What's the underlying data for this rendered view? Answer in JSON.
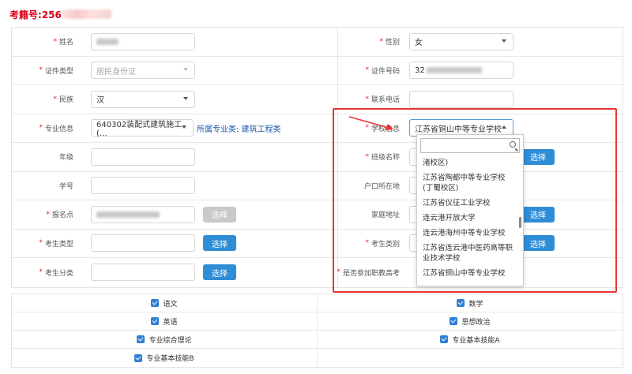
{
  "exam_no": {
    "label": "考籍号:",
    "value": "256"
  },
  "form": {
    "name": {
      "label": "姓名"
    },
    "gender": {
      "label": "性别",
      "value": "女"
    },
    "id_type": {
      "label": "证件类型",
      "value": "居民身份证"
    },
    "id_number": {
      "label": "证件号码",
      "value": "32"
    },
    "ethnicity": {
      "label": "民族",
      "value": "汉"
    },
    "phone": {
      "label": "联系电话"
    },
    "major": {
      "label": "专业信息",
      "value": "640302装配式建筑施工(…",
      "category": "所属专业类: 建筑工程类"
    },
    "school": {
      "label": "学校信息",
      "value": "江苏省铜山中等专业学校"
    },
    "grade_no": {
      "label": "年级"
    },
    "class_name": {
      "label": "班级名称",
      "button": "选择"
    },
    "student_no": {
      "label": "学号"
    },
    "household": {
      "label": "户口所在地"
    },
    "exam_site": {
      "label": "报名点",
      "button": "选择"
    },
    "home_address": {
      "label": "家庭地址",
      "button": "选择"
    },
    "candidate_type": {
      "label": "考生类型",
      "button": "选择"
    },
    "candidate_category": {
      "label": "考生类别",
      "button": "选择"
    },
    "candidate_class": {
      "label": "考生分类",
      "button": "选择"
    },
    "vocational": {
      "label": "是否参加职教高考"
    }
  },
  "dropdown": {
    "items": [
      "渚校区)",
      "江苏省陶都中等专业学校(丁蜀校区)",
      "江苏省仪征工业学校",
      "连云港开放大学",
      "连云港海州中等专业学校",
      "江苏省连云港中医药高等职业技术学校",
      "江苏省铜山中等专业学校"
    ]
  },
  "subjects": [
    [
      "语文",
      "数学"
    ],
    [
      "英语",
      "思想政治"
    ],
    [
      "专业综合理论",
      "专业基本技能A"
    ],
    [
      "专业基本技能B",
      ""
    ]
  ],
  "colors": {
    "accent": "#2f8dd6",
    "required": "#e02020",
    "highlight": "#e83535",
    "exam_no": "#d9001b"
  }
}
